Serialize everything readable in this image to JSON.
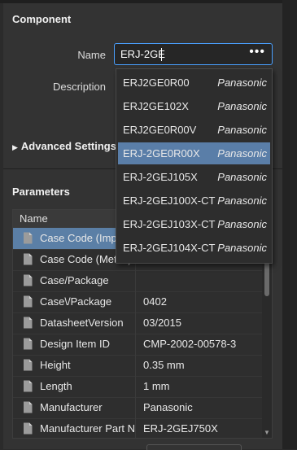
{
  "component": {
    "title": "Component",
    "name_label": "Name",
    "name_value": "ERJ-2GE",
    "more_button": "•••",
    "description_label": "Description"
  },
  "advanced": {
    "label": "Advanced Settings"
  },
  "parameters": {
    "title": "Parameters",
    "column_name": "Name",
    "rows": [
      {
        "name": "Case Code (Imperial)",
        "value": ""
      },
      {
        "name": "Case Code (Metric)",
        "value": ""
      },
      {
        "name": "Case/Package",
        "value": ""
      },
      {
        "name": "Case\\/Package",
        "value": "0402"
      },
      {
        "name": "DatasheetVersion",
        "value": "03/2015"
      },
      {
        "name": "Design Item ID",
        "value": "CMP-2002-00578-3"
      },
      {
        "name": "Height",
        "value": "0.35 mm"
      },
      {
        "name": "Length",
        "value": "1 mm"
      },
      {
        "name": "Manufacturer",
        "value": "Panasonic"
      },
      {
        "name": "Manufacturer Part Number",
        "value": "ERJ-2GEJ750X"
      }
    ]
  },
  "dropdown": {
    "items": [
      {
        "part": "ERJ2GE0R00",
        "manufacturer": "Panasonic"
      },
      {
        "part": "ERJ2GE102X",
        "manufacturer": "Panasonic"
      },
      {
        "part": "ERJ2GE0R00V",
        "manufacturer": "Panasonic"
      },
      {
        "part": "ERJ-2GE0R00X",
        "manufacturer": "Panasonic"
      },
      {
        "part": "ERJ-2GEJ105X",
        "manufacturer": "Panasonic"
      },
      {
        "part": "ERJ-2GEJ100X-CT",
        "manufacturer": "Panasonic"
      },
      {
        "part": "ERJ-2GEJ103X-CT",
        "manufacturer": "Panasonic"
      },
      {
        "part": "ERJ-2GEJ104X-CT",
        "manufacturer": "Panasonic"
      }
    ],
    "active_index": 3
  },
  "colors": {
    "accent": "#4aa0ff",
    "selection": "#5b7fa6",
    "panel_bg": "#333333"
  },
  "icons": {
    "row_icon": "document-icon",
    "expand": "triangle-right-icon"
  }
}
